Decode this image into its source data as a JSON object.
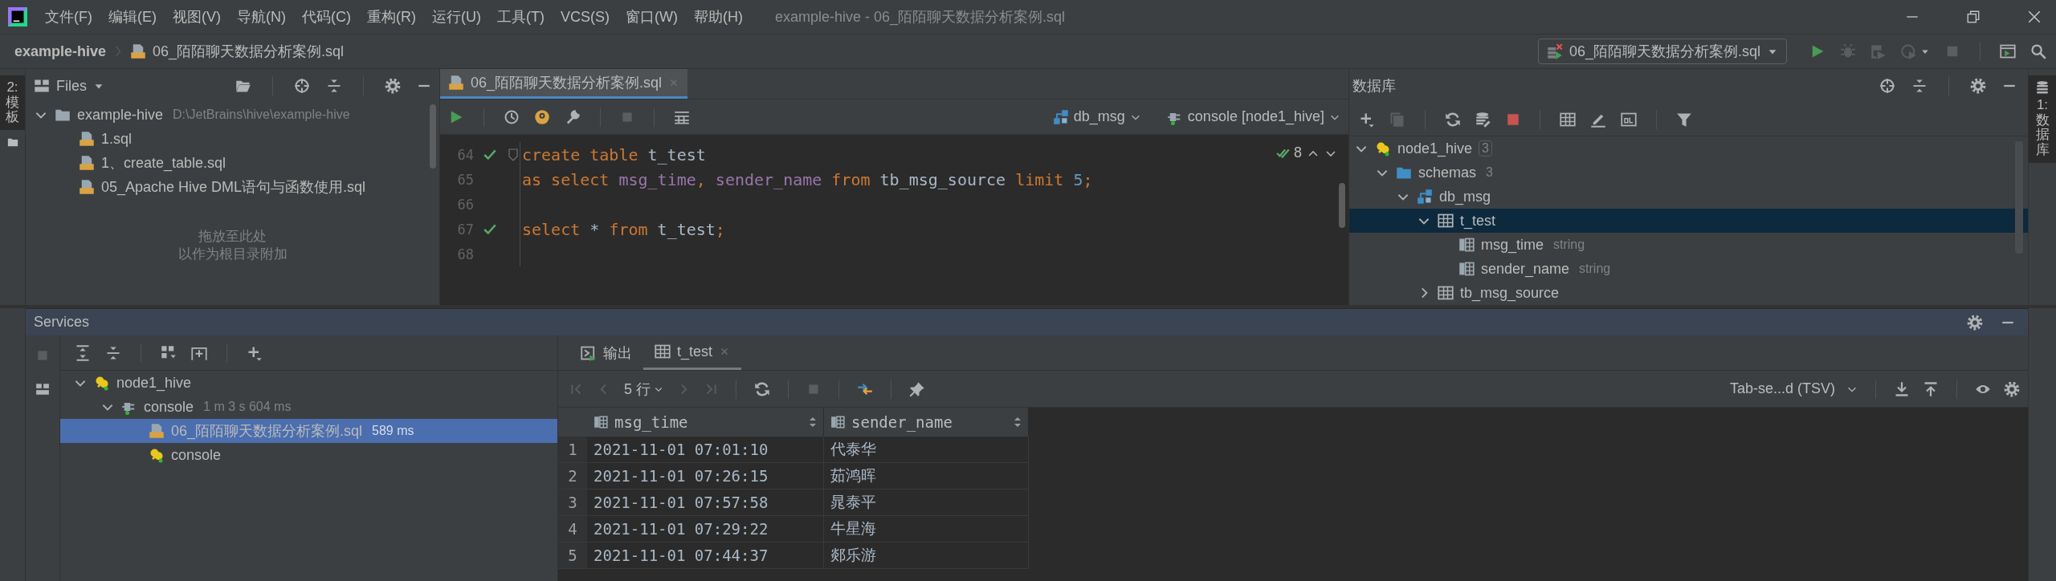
{
  "window": {
    "title": "example-hive - 06_陌陌聊天数据分析案例.sql"
  },
  "menu": [
    "文件(F)",
    "编辑(E)",
    "视图(V)",
    "导航(N)",
    "代码(C)",
    "重构(R)",
    "运行(U)",
    "工具(T)",
    "VCS(S)",
    "窗口(W)",
    "帮助(H)"
  ],
  "navbar": {
    "breadcrumb": [
      "example-hive",
      "06_陌陌聊天数据分析案例.sql"
    ],
    "run_config": "06_陌陌聊天数据分析案例.sql"
  },
  "left_stripe": {
    "tabs": [
      {
        "label": "2: 模板",
        "selected": true
      }
    ]
  },
  "right_stripe": {
    "tabs": [
      {
        "label": "1: 数据库",
        "selected": true
      }
    ]
  },
  "files_panel": {
    "title": "Files",
    "tree": [
      {
        "label": "example-hive",
        "kind": "project",
        "path": "D:\\JetBrains\\hive\\example-hive",
        "expanded": true,
        "selected": false,
        "children": [
          {
            "label": "1.sql",
            "kind": "sql",
            "selected": false
          },
          {
            "label": "1、create_table.sql",
            "kind": "sql",
            "selected": false
          },
          {
            "label": "05_Apache Hive DML语句与函数使用.sql",
            "kind": "sql",
            "selected": false
          }
        ]
      }
    ],
    "drop_hint": [
      "拖放至此处",
      "以作为根目录附加"
    ]
  },
  "editor": {
    "tabs": [
      {
        "label": "06_陌陌聊天数据分析案例.sql",
        "selected": true
      }
    ],
    "schema": "db_msg",
    "session": "console [node1_hive]",
    "inspections": "8",
    "lines": [
      {
        "number": "64",
        "ok": true,
        "fold": true,
        "tokens": [
          {
            "kind": "keyword",
            "text": "create table"
          },
          {
            "kind": "text",
            "text": " t_test"
          }
        ]
      },
      {
        "number": "65",
        "ok": false,
        "fold": false,
        "tokens": [
          {
            "kind": "keyword",
            "text": "as select "
          },
          {
            "kind": "field",
            "text": "msg_time"
          },
          {
            "kind": "punct",
            "text": ", "
          },
          {
            "kind": "field",
            "text": "sender_name"
          },
          {
            "kind": "keyword",
            "text": " from"
          },
          {
            "kind": "text",
            "text": " tb_msg_source "
          },
          {
            "kind": "keyword",
            "text": "limit "
          },
          {
            "kind": "number",
            "text": "5"
          },
          {
            "kind": "punct",
            "text": ";"
          }
        ]
      },
      {
        "number": "66",
        "ok": false,
        "fold": false
      },
      {
        "number": "67",
        "ok": true,
        "fold": false,
        "tokens": [
          {
            "kind": "keyword",
            "text": "select"
          },
          {
            "kind": "text",
            "text": " * "
          },
          {
            "kind": "keyword",
            "text": "from"
          },
          {
            "kind": "text",
            "text": " t_test"
          },
          {
            "kind": "punct",
            "text": ";"
          }
        ]
      },
      {
        "number": "68",
        "ok": false,
        "fold": false
      }
    ]
  },
  "database": {
    "title": "数据库",
    "tree": [
      {
        "label": "node1_hive",
        "kind": "datasource",
        "count": "3",
        "expanded": true,
        "selected": false,
        "children": [
          {
            "label": "schemas",
            "kind": "folder",
            "count": "3",
            "expanded": true,
            "selected": false,
            "children": [
              {
                "label": "db_msg",
                "kind": "schema",
                "expanded": true,
                "selected": false,
                "children": [
                  {
                    "label": "t_test",
                    "kind": "table",
                    "expanded": true,
                    "selected": true,
                    "children": [
                      {
                        "label": "msg_time",
                        "kind": "column",
                        "type": "string",
                        "selected": false
                      },
                      {
                        "label": "sender_name",
                        "kind": "column",
                        "type": "string",
                        "selected": false
                      }
                    ]
                  },
                  {
                    "label": "tb_msg_source",
                    "kind": "table",
                    "expanded": false,
                    "selected": false
                  }
                ]
              }
            ]
          }
        ]
      }
    ]
  },
  "services": {
    "title": "Services",
    "tree": [
      {
        "label": "node1_hive",
        "kind": "datasource",
        "expanded": true,
        "selected": false,
        "children": [
          {
            "label": "console",
            "kind": "session",
            "meta": "1 m 3 s 604 ms",
            "expanded": true,
            "selected": false,
            "children": [
              {
                "label": "06_陌陌聊天数据分析案例.sql",
                "kind": "sql",
                "meta": "589 ms",
                "selected": true
              },
              {
                "label": "console",
                "kind": "console",
                "selected": false
              }
            ]
          }
        ]
      }
    ],
    "result_tabs": [
      {
        "label": "输出",
        "kind": "output",
        "selected": false
      },
      {
        "label": "t_test",
        "kind": "table",
        "selected": true
      }
    ],
    "page_size": "5 行",
    "export_format": "Tab-se...d (TSV)",
    "table": {
      "columns": [
        "msg_time",
        "sender_name"
      ],
      "rows": [
        {
          "number": "1",
          "cells": [
            "2021-11-01 07:01:10",
            "代泰华"
          ]
        },
        {
          "number": "2",
          "cells": [
            "2021-11-01 07:26:15",
            "茹鸿晖"
          ]
        },
        {
          "number": "3",
          "cells": [
            "2021-11-01 07:57:58",
            "晁泰平"
          ]
        },
        {
          "number": "4",
          "cells": [
            "2021-11-01 07:29:22",
            "牛星海"
          ]
        },
        {
          "number": "5",
          "cells": [
            "2021-11-01 07:44:37",
            "郯乐游"
          ]
        }
      ]
    }
  }
}
